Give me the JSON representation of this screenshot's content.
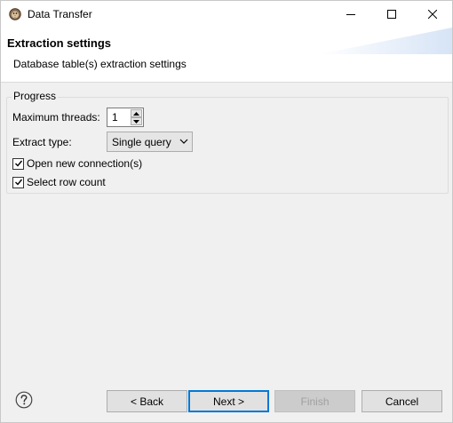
{
  "window": {
    "title": "Data Transfer",
    "icon": "dbeaver-beaver-icon"
  },
  "header": {
    "title": "Extraction settings",
    "description": "Database table(s) extraction settings"
  },
  "group": {
    "legend": "Progress",
    "max_threads_label": "Maximum threads:",
    "max_threads_value": "1",
    "extract_type_label": "Extract type:",
    "extract_type_value": "Single query",
    "open_new_connection_label": "Open new connection(s)",
    "open_new_connection_checked": true,
    "select_row_count_label": "Select row count",
    "select_row_count_checked": true
  },
  "footer": {
    "back_label": "< Back",
    "next_label": "Next >",
    "finish_label": "Finish",
    "cancel_label": "Cancel"
  },
  "colors": {
    "accent": "#0078d7",
    "window_bg": "#f0f0f0",
    "button_bg": "#e1e1e1"
  }
}
